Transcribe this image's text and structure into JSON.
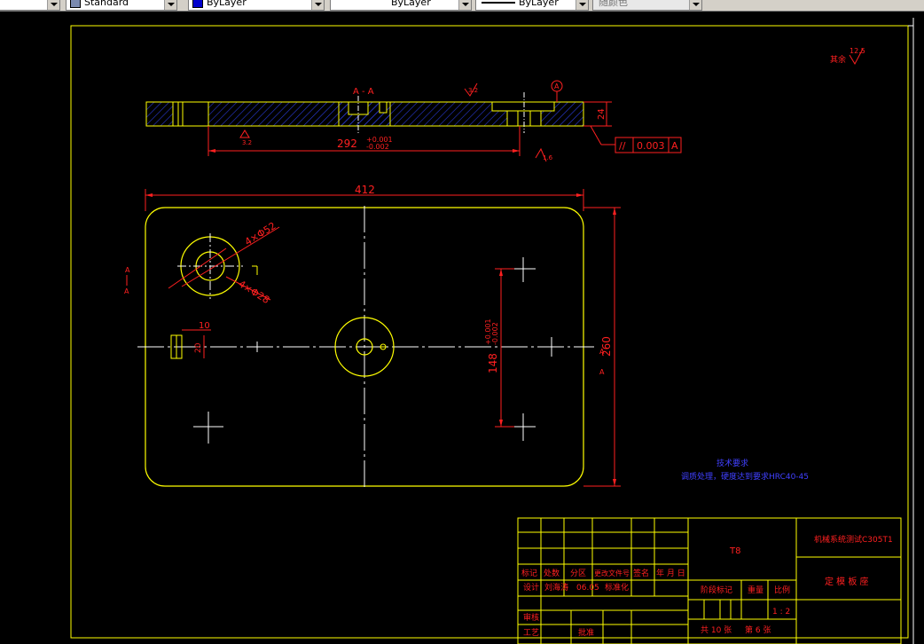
{
  "toolbar": {
    "text_style": "Standard",
    "layer_color": "ByLayer",
    "linetype": "ByLayer",
    "lineweight": "ByLayer",
    "plot_style": "随颜色"
  },
  "drawing": {
    "section_label": "A - A",
    "section_mark": "A",
    "roughness_top": "3.2",
    "roughness_bottom": "3.2",
    "roughness_side": "1.6",
    "roughness_corner": "12.5",
    "roughness_corner_prefix": "其余",
    "datum_symbol": "A",
    "thickness_dim": "24",
    "length_292": "292",
    "tol_plus": "+0.001",
    "tol_minus": "-0.002",
    "flatness_symbol": "//",
    "flatness_value": "0.003",
    "flatness_datum": "A",
    "width_dim": "412",
    "height_dim": "260",
    "hole_big": "4×Φ52",
    "hole_small": "4×Φ28",
    "dim_10": "10",
    "dim_20": "20",
    "dim_148": "148",
    "tech_title": "技术要求",
    "tech_text": "调质处理，硬度达到要求HRC40-45"
  },
  "title_block": {
    "material": "T8",
    "company": "机械系统测试C305T1",
    "part_name": "定 模 板 座",
    "headers": [
      "标记",
      "处数",
      "分区",
      "更改文件号",
      "签名",
      "年 月 日"
    ],
    "design_row": [
      "设计",
      "刘海涛",
      "06.05",
      "标准化"
    ],
    "review_label": "审核",
    "process_label": "工艺",
    "approve_label": "批准",
    "stage_label": "阶段标记",
    "weight_label": "重量",
    "scale_label": "比例",
    "scale_value": "1 : 2",
    "sheets_total": "共 10 张",
    "sheet_no": "第 6 张"
  }
}
